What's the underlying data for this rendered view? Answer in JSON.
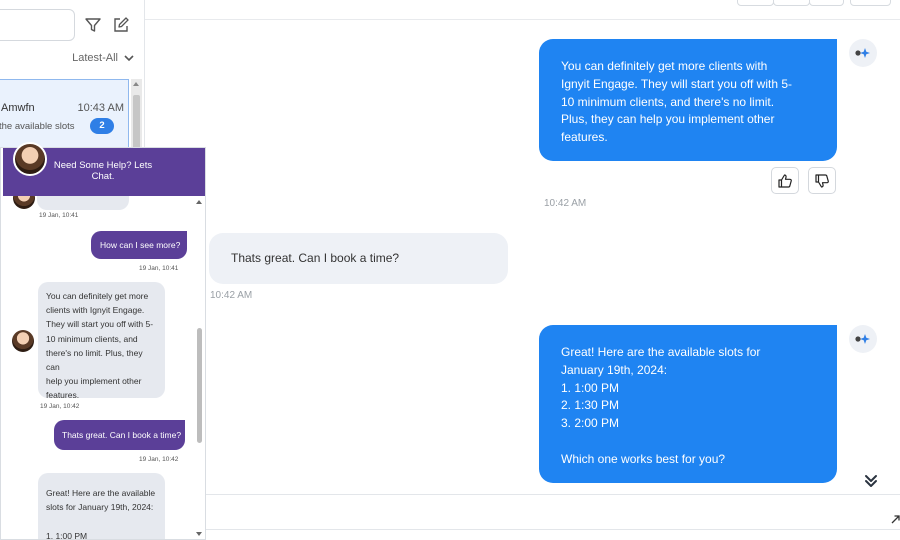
{
  "left_panel": {
    "sort_label": "Latest-All",
    "conversation": {
      "name": "Amwfn",
      "time": "10:43 AM",
      "preview": "the available slots",
      "unread_count": "2"
    }
  },
  "main_chat": {
    "messages": [
      {
        "text": "You can definitely get more clients with\nIgnyit Engage. They will start you off with 5-\n10 minimum clients, and there's no limit.\nPlus, they can help you implement other\nfeatures.",
        "time": "10:42 AM"
      },
      {
        "text": "Thats great. Can I book a time?",
        "time": "10:42 AM"
      },
      {
        "text": "Great! Here are the available slots for\nJanuary 19th, 2024:\n1. 1:00 PM\n2. 1:30 PM\n3. 2:00 PM\n\nWhich one works best for you?"
      }
    ]
  },
  "widget": {
    "title": "Need Some Help? Lets Chat.",
    "messages": [
      {
        "time": "19 Jan, 10:41"
      },
      {
        "text": "How can I see more?",
        "time": "19 Jan, 10:41"
      },
      {
        "text": "You can definitely get more\nclients with Ignyit Engage.\nThey will start you off with 5-\n10 minimum clients, and\nthere's no limit. Plus, they can\nhelp you implement other\nfeatures.",
        "time": "19 Jan, 10:42"
      },
      {
        "text": "Thats great. Can I book a time?",
        "time": "19 Jan, 10:42"
      },
      {
        "text": "Great! Here are the available\nslots for January 19th, 2024:\n\n1. 1:00 PM"
      }
    ]
  },
  "colors": {
    "outgoing_bubble": "#1f84f2",
    "widget_purple": "#5b3f98",
    "unread_badge": "#2f7fe6"
  }
}
